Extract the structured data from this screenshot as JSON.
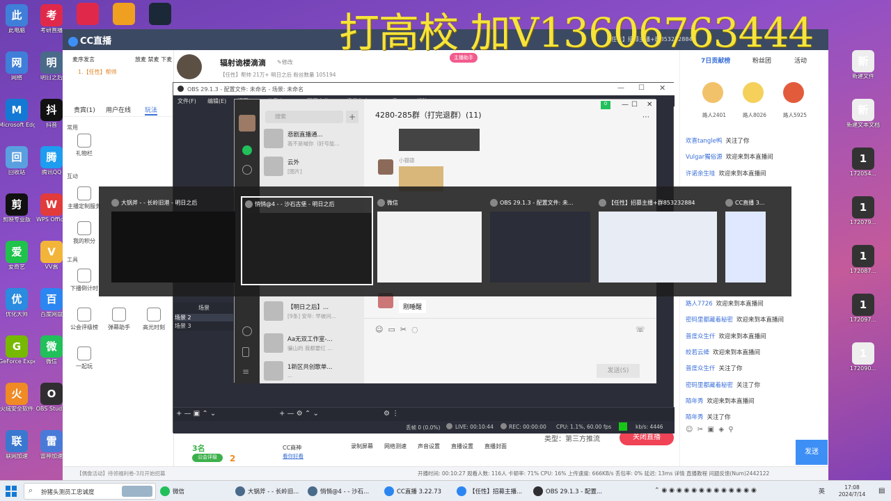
{
  "watermark": "打高校 加V13606763444",
  "desktop_icons_left": [
    {
      "label": "此电脑",
      "color": "#3f7fd9"
    },
    {
      "label": "网络",
      "color": "#3f7fd9"
    },
    {
      "label": "Microsoft Edge",
      "color": "#1479d4"
    },
    {
      "label": "回收站",
      "color": "#5aa0e0"
    },
    {
      "label": "剪映专业版",
      "color": "#111111"
    },
    {
      "label": "爱奇艺",
      "color": "#1fc24b"
    },
    {
      "label": "优化大师",
      "color": "#2a8be0"
    },
    {
      "label": "GeForce Experience",
      "color": "#76b900"
    },
    {
      "label": "火绒安全软件",
      "color": "#f08a24"
    },
    {
      "label": "联网加速",
      "color": "#3a78d0"
    }
  ],
  "desktop_icons_col2": [
    {
      "label": "考研直播",
      "color": "#e0294a"
    },
    {
      "label": "明日之后",
      "color": "#4a6a8a"
    },
    {
      "label": "抖音",
      "color": "#111111"
    },
    {
      "label": "腾讯QQ",
      "color": "#1d9cf0"
    },
    {
      "label": "WPS Office",
      "color": "#e23b3b"
    },
    {
      "label": "VV酱",
      "color": "#f2b53a"
    },
    {
      "label": "百度网盘",
      "color": "#2c86f2"
    },
    {
      "label": "微信",
      "color": "#21c05a"
    },
    {
      "label": "OBS Studio",
      "color": "#302e31"
    },
    {
      "label": "雷神加速",
      "color": "#4a7ad8"
    }
  ],
  "desktop_icons_top": [
    {
      "label": "",
      "color": "#e0294a"
    },
    {
      "label": "",
      "color": "#f0a020"
    },
    {
      "label": "",
      "color": "#1b2838"
    }
  ],
  "desktop_icons_right": [
    {
      "label": "新建文件",
      "color": "#eeeeee"
    },
    {
      "label": "新建文本文档",
      "color": "#eeeeee"
    },
    {
      "label": "172054...",
      "color": "#333333"
    },
    {
      "label": "172079...",
      "color": "#333333"
    },
    {
      "label": "172087...",
      "color": "#333333"
    },
    {
      "label": "172097...",
      "color": "#333333"
    },
    {
      "label": "172090...",
      "color": "#eeeeee"
    }
  ],
  "cc": {
    "app_name": "CC直播",
    "title_right": "【任性】招募主播+群853232884",
    "order_label": "麦序发言",
    "order_right": "放麦 禁麦 下麦",
    "order_user": "1.【任性】帮帅",
    "streamer_name": "辐射诡楼滴滴",
    "edit_label": "修改",
    "streamer_meta": "【任性】帮帅  21万+  明日之后  粉丝数量 105194",
    "assistant_badge": "主播助手",
    "left_tabs": [
      "贵宾(1)",
      "用户在线",
      "玩法"
    ],
    "section_common": "常用",
    "section_interact": "互动",
    "section_tools": "工具",
    "tools": [
      {
        "label": "礼物栏",
        "section": "common"
      },
      {
        "label": "主播定制服务",
        "section": "interact"
      },
      {
        "label": "我的积分",
        "section": "interact"
      },
      {
        "label": "下播倒计时",
        "section": "tools"
      },
      {
        "label": "公会评级榜",
        "section": "tools"
      },
      {
        "label": "弹幕助手",
        "section": "tools"
      },
      {
        "label": "高光时刻",
        "section": "tools"
      },
      {
        "label": "一起玩",
        "section": "tools"
      }
    ],
    "right_tabs": [
      "7日贡献榜",
      "粉丝团",
      "活动"
    ],
    "top_fans": [
      {
        "name": "路人2401"
      },
      {
        "name": "路人8026"
      },
      {
        "name": "路人5925"
      }
    ],
    "chat_top": [
      {
        "user": "欢喜tangle鸭",
        "msg": "关注了你"
      },
      {
        "user": "Vulgar獨俗源",
        "msg": "欢迎来到本直播间"
      },
      {
        "user": "许诺余生哇",
        "msg": "欢迎来到本直播间"
      }
    ],
    "chat_bottom": [
      {
        "user": "路人7726",
        "msg": "欢迎来到本直播间"
      },
      {
        "user": "密码里都藏着秘密",
        "msg": "欢迎来到本直播间"
      },
      {
        "user": "普度众生仟",
        "msg": "欢迎来到本直播间"
      },
      {
        "user": "皎若云縴",
        "msg": "欢迎来到本直播间"
      },
      {
        "user": "普度众生仟",
        "msg": "关注了你"
      },
      {
        "user": "密码里都藏着秘密",
        "msg": "关注了你"
      },
      {
        "user": "陌年秀",
        "msg": "欢迎来到本直播间"
      },
      {
        "user": "陌年秀",
        "msg": "关注了你"
      }
    ],
    "send_button": "发送",
    "stream_type": "类型：第三方推流",
    "close_stream": "关闭直播",
    "bottom_actions": [
      "录制屏幕",
      "网络测速",
      "声音设置",
      "直播设置",
      "直播封面"
    ],
    "cc_company": "CC商神",
    "cc_sub": "看你好看",
    "rank_num": "3名",
    "rank_num2": "2",
    "guild_label": "公会评级",
    "status_bar": "开播时间: 00:10:27   观看人数: 116人   卡顿率: 71%   CPU: 16%   上传速度: 666KB/s   丢包率: 0%   延迟: 13ms   详情   直播教程   问题反馈(Num)2442122",
    "notice_bar": "【偶像活动】待领福利卷-3月开始招募"
  },
  "obs": {
    "title": "OBS 29.1.3 - 配置文件: 未命名 - 场景: 未命名",
    "menu": [
      "文件(F)",
      "编辑(E)",
      "视图(V)",
      "停靠窗口(D)",
      "配置文件(P)",
      "场景集合(S)",
      "工具(T)",
      "帮助(H)"
    ],
    "scenes_header": "场景",
    "scenes": [
      "场景 2",
      "场景 3"
    ],
    "status": {
      "dropped": "丢帧 0 (0.0%)",
      "live": "LIVE: 00:10:44",
      "rec": "REC: 00:00:00",
      "cpu": "CPU: 1.1%, 60.00 fps",
      "kbps": "kb/s: 4446"
    }
  },
  "wechat": {
    "search_placeholder": "搜索",
    "chat_title": "4280-285群（打完退群）(11)",
    "contacts": [
      {
        "name": "悲剧直播通...",
        "preview": "我不是喊你（好号能..."
      },
      {
        "name": "云外",
        "preview": "[图片]"
      },
      {
        "name": "【明日之后】...",
        "preview": "[9条] 安年: 早被问..."
      },
      {
        "name": "Aa无双工作室-...",
        "preview": "骗山的 我都要红 ..."
      },
      {
        "name": "1新区共创歌单...",
        "preview": "..."
      }
    ],
    "msg_sender": "小猫德",
    "last_msg": "刚睡醒",
    "send_button": "发送(S)"
  },
  "switcher": {
    "windows": [
      {
        "title": "大锅斧 - - 长岭旧港 - 明日之后",
        "thumb_bg": "#111111"
      },
      {
        "title": "悄悄@4 - - 沙石古堡 - 明日之后",
        "thumb_bg": "#1e1e1e"
      },
      {
        "title": "微信",
        "thumb_bg": "#f2f2f2"
      },
      {
        "title": "OBS 29.1.3 - 配置文件: 未...",
        "thumb_bg": "#2b2e38"
      },
      {
        "title": "【任性】招募主播+群853232884",
        "thumb_bg": "#e8ecf5"
      },
      {
        "title": "CC直播 3...",
        "thumb_bg": "#dfe8ff"
      }
    ],
    "active_index": 1
  },
  "taskbar": {
    "search_placeholder": "扮猪头测员工忠诚度",
    "items": [
      {
        "label": "微信",
        "color": "#21c05a"
      },
      {
        "label": "大锅斧 - - 长岭旧...",
        "color": "#4a6a8a"
      },
      {
        "label": "悄悄@4 - - 沙石...",
        "color": "#4a6a8a"
      },
      {
        "label": "CC直播 3.22.73",
        "color": "#2c86f2"
      },
      {
        "label": "【任性】招募主播...",
        "color": "#2c86f2"
      },
      {
        "label": "OBS 29.1.3 - 配置...",
        "color": "#302e31"
      }
    ],
    "ime": "英",
    "time": "17:08",
    "date": "2024/7/14"
  }
}
